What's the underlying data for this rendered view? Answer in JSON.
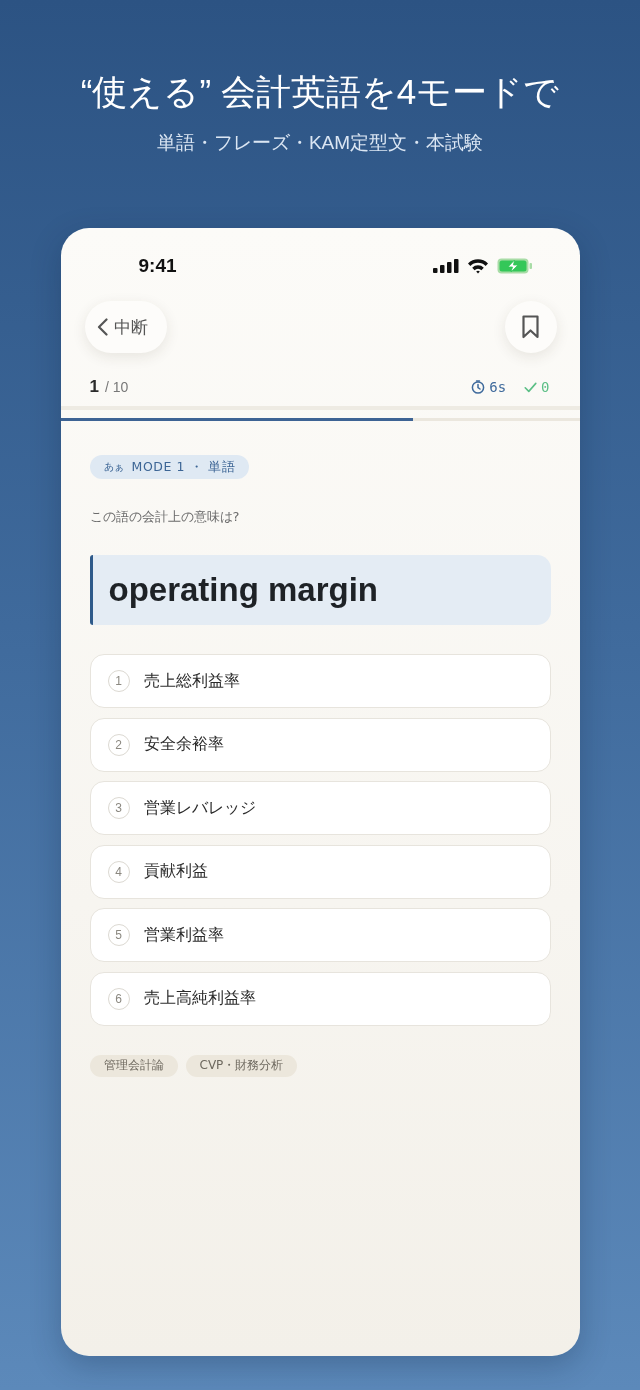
{
  "header": {
    "title": "“使える” 会計英語を4モードで",
    "subtitle": "単語・フレーズ・KAM定型文・本試験"
  },
  "status_bar": {
    "time": "9:41"
  },
  "nav": {
    "back_label": "中断"
  },
  "progress": {
    "current": "1",
    "total": "/ 10",
    "level": 0.68
  },
  "stats": {
    "time": "6s",
    "correct": "0"
  },
  "mode_badge": {
    "glyph": "あぁ",
    "label": "MODE 1 ・ 単語"
  },
  "prompt": "この語の会計上の意味は?",
  "term": "operating margin",
  "options": [
    {
      "number": "1",
      "label": "売上総利益率",
      "selected": false
    },
    {
      "number": "2",
      "label": "安全余裕率",
      "selected": false
    },
    {
      "number": "3",
      "label": "営業レバレッジ",
      "selected": false
    },
    {
      "number": "4",
      "label": "貢献利益",
      "selected": false
    },
    {
      "number": "5",
      "label": "営業利益率",
      "selected": false
    },
    {
      "number": "6",
      "label": "売上高純利益率",
      "selected": false
    }
  ],
  "tags": [
    "管理会計論",
    "CVP・財務分析"
  ]
}
